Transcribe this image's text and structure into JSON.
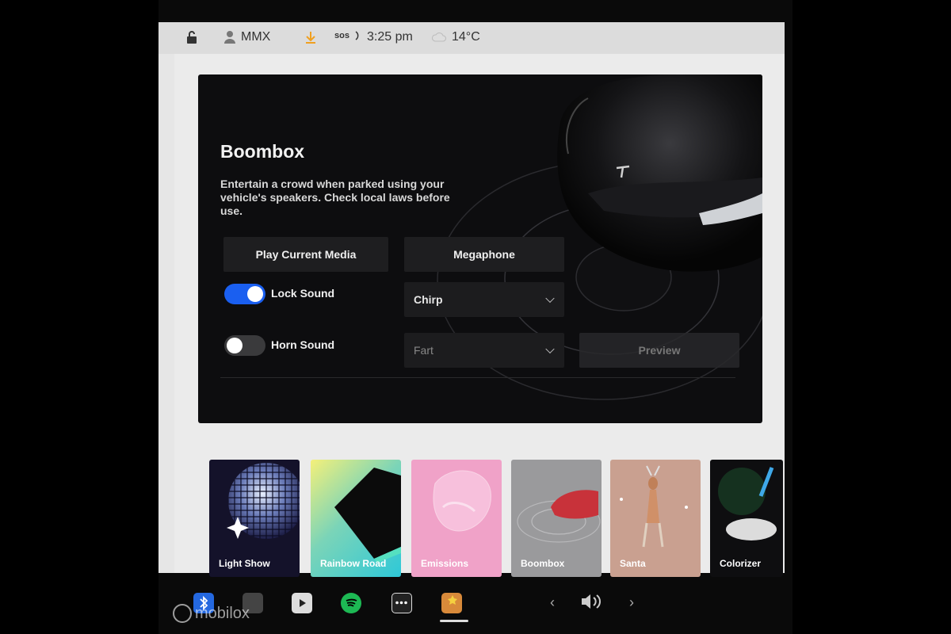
{
  "status_bar": {
    "profile_name": "MMX",
    "sos_label": "sos",
    "time": "3:25 pm",
    "temperature": "14°C"
  },
  "boombox": {
    "title": "Boombox",
    "description": "Entertain a crowd when parked using your vehicle's speakers. Check local laws before use.",
    "play_current_media_label": "Play Current Media",
    "megaphone_label": "Megaphone",
    "lock_sound_label": "Lock Sound",
    "lock_sound_on": true,
    "lock_sound_value": "Chirp",
    "horn_sound_label": "Horn Sound",
    "horn_sound_on": false,
    "horn_sound_value": "Fart",
    "preview_label": "Preview"
  },
  "toybox": {
    "cards": [
      {
        "label": "Light Show"
      },
      {
        "label": "Rainbow Road"
      },
      {
        "label": "Emissions"
      },
      {
        "label": "Boombox"
      },
      {
        "label": "Santa"
      },
      {
        "label": "Colorizer"
      }
    ]
  },
  "dock": {
    "watermark": "mobilox"
  },
  "colors": {
    "toggle_on": "#1a5ff0",
    "toggle_off": "#3a3a3c",
    "panel_bg": "#0d0d0f"
  }
}
